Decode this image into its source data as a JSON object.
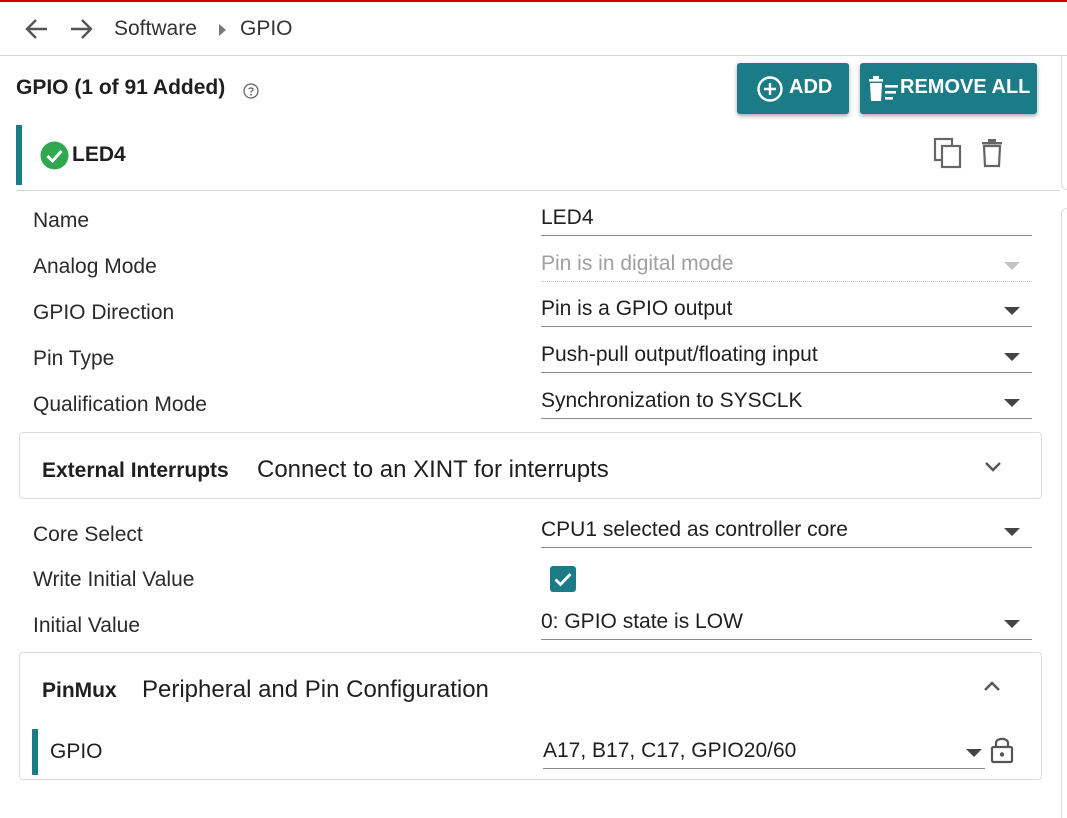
{
  "breadcrumb": {
    "items": [
      "Software",
      "GPIO"
    ]
  },
  "header": {
    "title": "GPIO (1 of 91 Added)",
    "add_label": "ADD",
    "remove_all_label": "REMOVE ALL"
  },
  "item": {
    "name": "LED4",
    "status": "valid"
  },
  "fields": {
    "name": {
      "label": "Name",
      "value": "LED4"
    },
    "analog_mode": {
      "label": "Analog Mode",
      "value": "Pin is in digital mode",
      "disabled": true
    },
    "gpio_direction": {
      "label": "GPIO Direction",
      "value": "Pin is a GPIO output"
    },
    "pin_type": {
      "label": "Pin Type",
      "value": "Push-pull output/floating input"
    },
    "qualification_mode": {
      "label": "Qualification Mode",
      "value": "Synchronization to SYSCLK"
    },
    "core_select": {
      "label": "Core Select",
      "value": "CPU1 selected as controller core"
    },
    "write_initial_value": {
      "label": "Write Initial Value",
      "checked": true
    },
    "initial_value": {
      "label": "Initial Value",
      "value": "0: GPIO state is LOW"
    }
  },
  "external_interrupts": {
    "title": "External Interrupts",
    "description": "Connect to an XINT for interrupts",
    "expanded": false
  },
  "pinmux": {
    "title": "PinMux",
    "description": "Peripheral and Pin Configuration",
    "expanded": true,
    "row": {
      "label": "GPIO",
      "value": "A17, B17, C17, GPIO20/60"
    }
  },
  "colors": {
    "accent": "#1b7b86",
    "success": "#2fa84f",
    "top_line": "#cc0000"
  },
  "icons": [
    "back-arrow-icon",
    "forward-arrow-icon",
    "help-icon",
    "add-circle-icon",
    "remove-all-icon",
    "check-circle-icon",
    "copy-icon",
    "trash-icon",
    "chevron-down-icon",
    "chevron-up-icon",
    "lock-icon"
  ]
}
